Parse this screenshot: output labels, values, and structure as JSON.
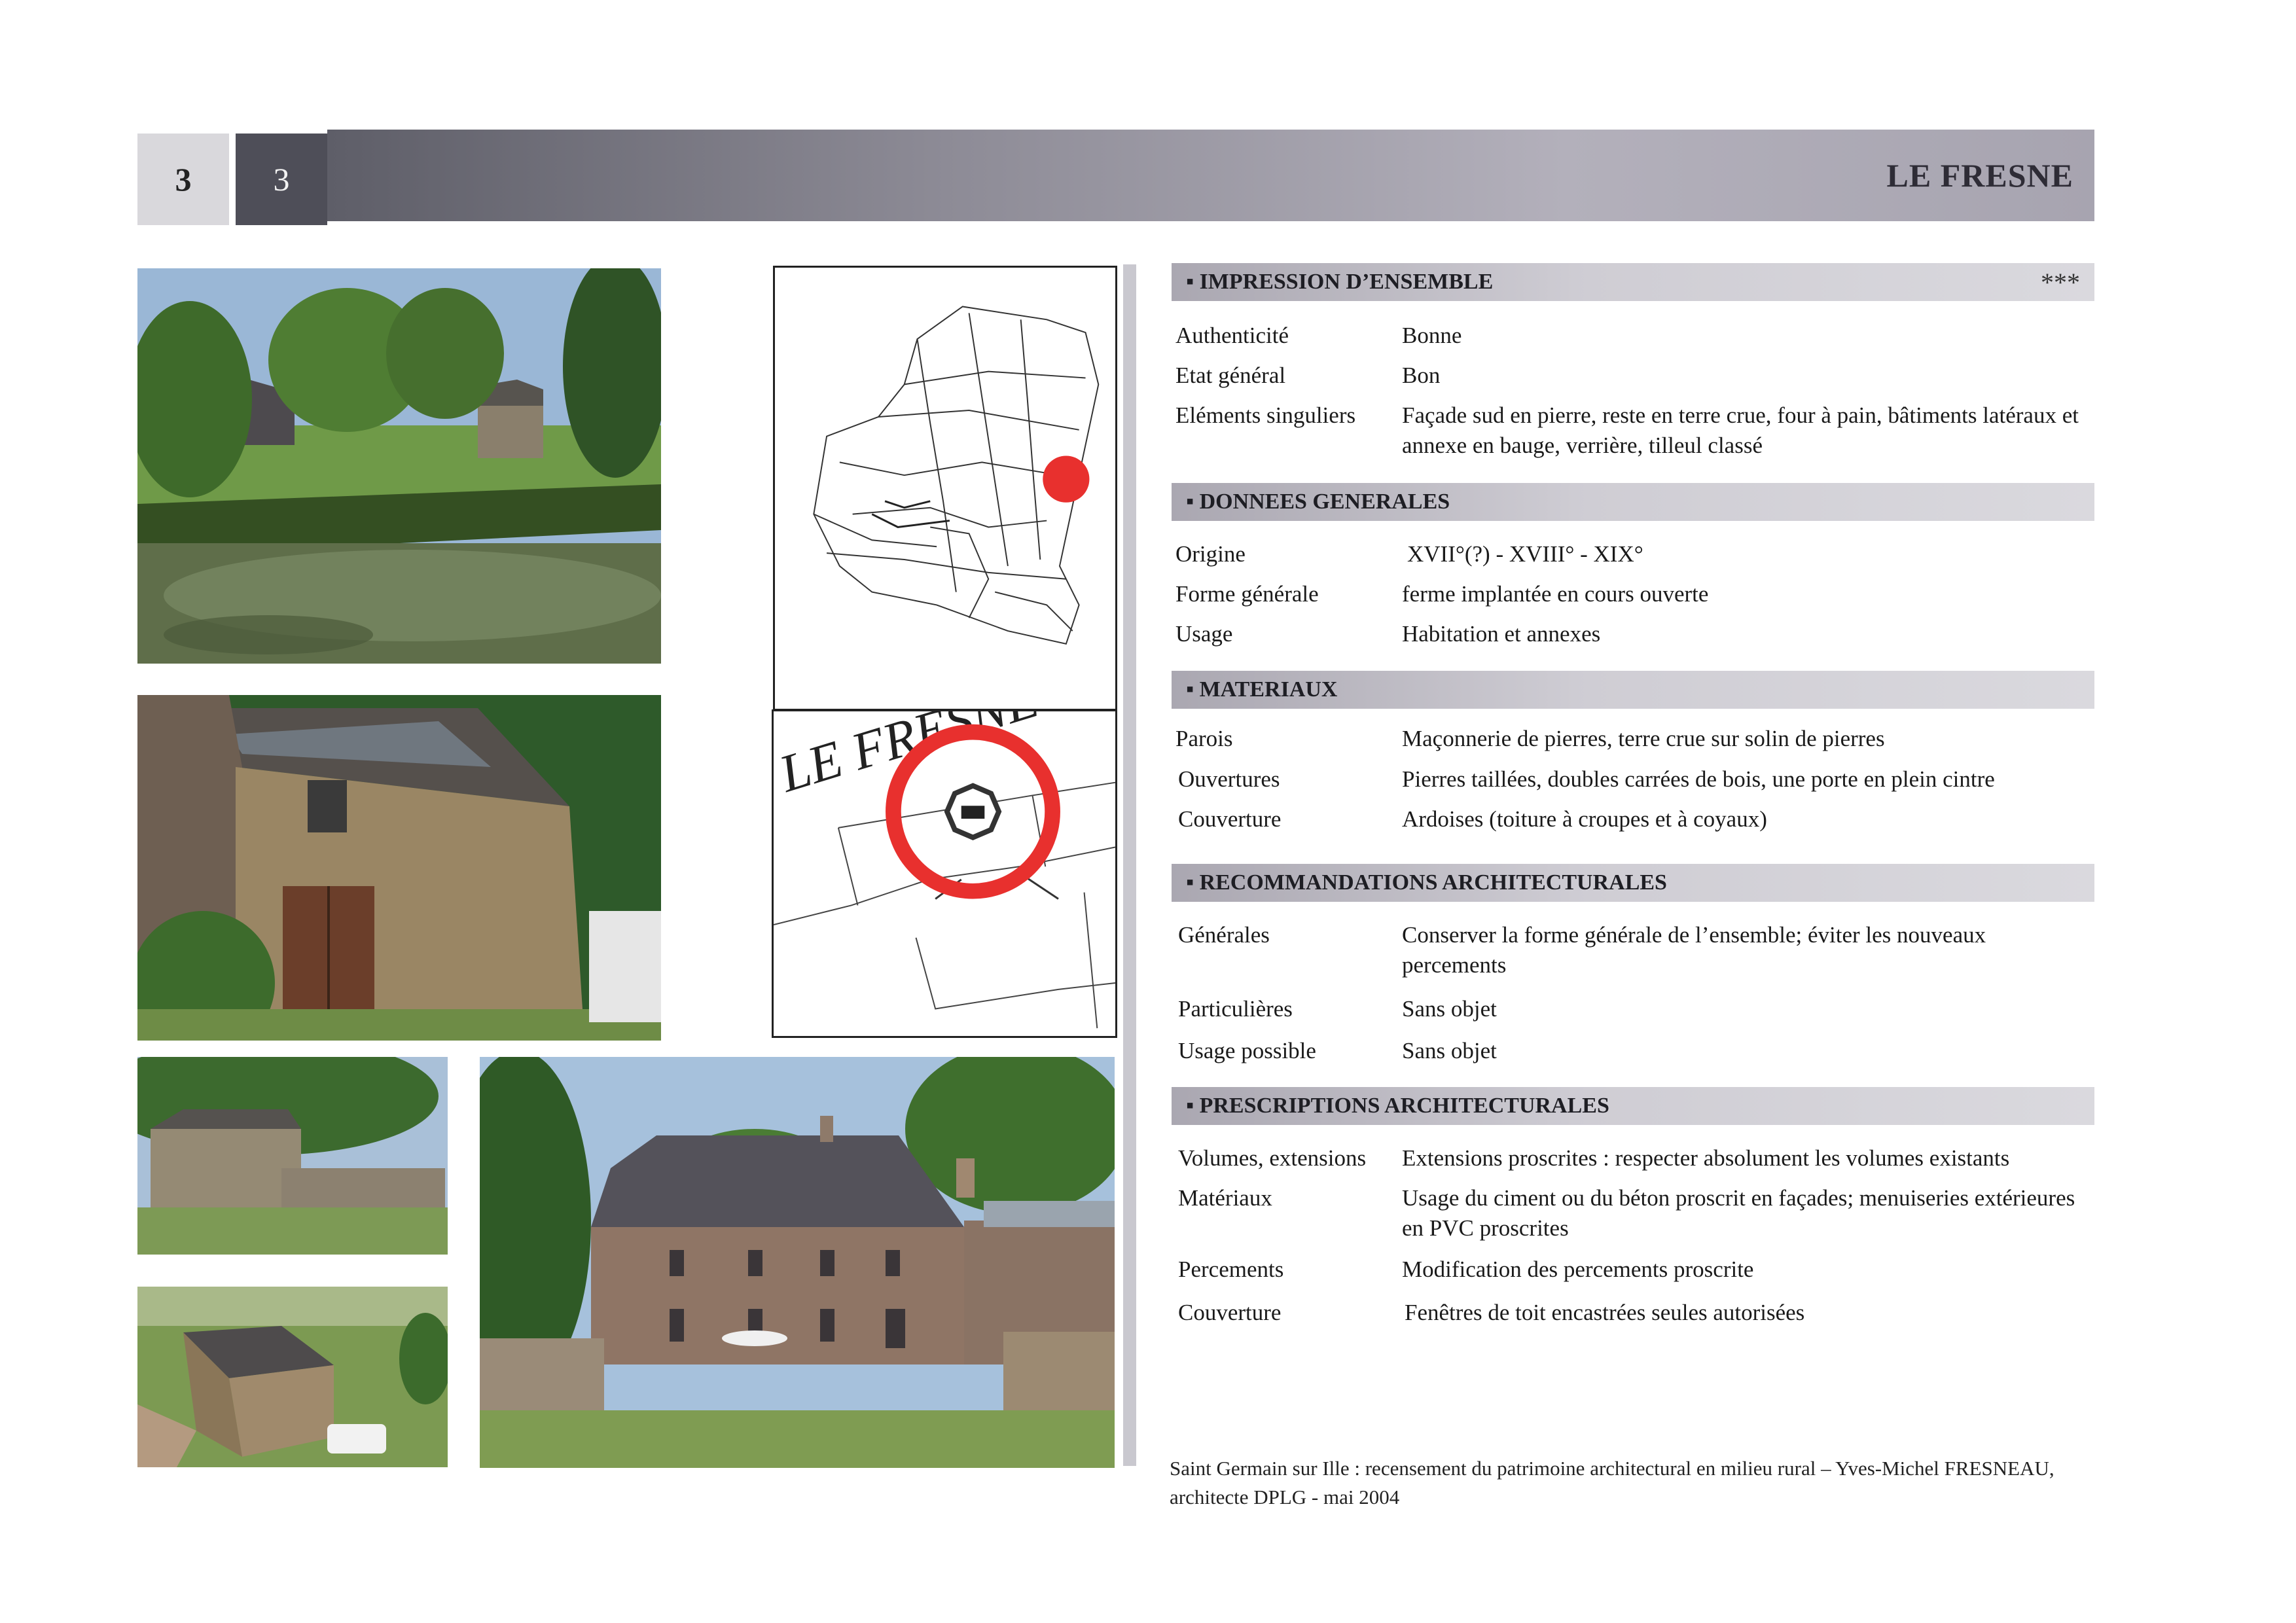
{
  "header": {
    "number_light": "3",
    "number_dark": "3",
    "title": "LE FRESNE"
  },
  "map_label": "LE FRESNE",
  "sections": [
    {
      "title": "IMPRESSION D’ENSEMBLE",
      "stars": "***",
      "rows": [
        {
          "label": "Authenticité",
          "value": "Bonne"
        },
        {
          "label": "Etat général",
          "value": "Bon"
        },
        {
          "label": "Eléments singuliers",
          "value": "Façade sud en pierre, reste en terre crue, four à pain, bâtiments latéraux et annexe en bauge, verrière, tilleul classé"
        }
      ]
    },
    {
      "title": "DONNEES GENERALES",
      "rows": [
        {
          "label": "Origine",
          "value": "XVII°(?) - XVIII° - XIX°"
        },
        {
          "label": "Forme générale",
          "value": "ferme implantée en cours ouverte"
        },
        {
          "label": "Usage",
          "value": "Habitation et annexes"
        }
      ]
    },
    {
      "title": "MATERIAUX",
      "rows": [
        {
          "label": "Parois",
          "value": "Maçonnerie de pierres,  terre crue sur solin de pierres"
        },
        {
          "label": "Ouvertures",
          "value": "Pierres taillées, doubles carrées de bois, une porte en plein cintre"
        },
        {
          "label": "Couverture",
          "value": "Ardoises (toiture à croupes et à coyaux)"
        }
      ]
    },
    {
      "title": "RECOMMANDATIONS ARCHITECTURALES",
      "rows": [
        {
          "label": "Générales",
          "value": "Conserver la forme générale de l’ensemble; éviter les nouveaux percements"
        },
        {
          "label": "Particulières",
          "value": "Sans objet"
        },
        {
          "label": "Usage possible",
          "value": "Sans objet"
        }
      ]
    },
    {
      "title": "PRESCRIPTIONS ARCHITECTURALES",
      "rows": [
        {
          "label": "Volumes, extensions",
          "value": "Extensions proscrites : respecter absolument les volumes existants"
        },
        {
          "label": "Matériaux",
          "value": "Usage du ciment ou du béton proscrit en façades; menuiseries extérieures en PVC proscrites"
        },
        {
          "label": "Percements",
          "value": "Modification des percements proscrite"
        },
        {
          "label": "Couverture",
          "value": "Fenêtres de toit encastrées seules autorisées"
        }
      ]
    }
  ],
  "footer": "Saint Germain sur Ille : recensement du patrimoine architectural en milieu rural – Yves-Michel FRESNEAU, architecte DPLG  - mai 2004",
  "colors": {
    "marker_red": "#e8302e",
    "header_dark": "#4e4e58",
    "section_band": "#cfcdd4"
  }
}
